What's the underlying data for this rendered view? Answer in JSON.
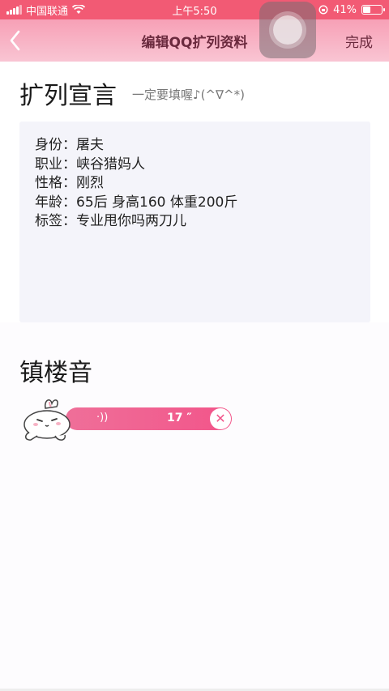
{
  "status_bar": {
    "carrier": "中国联通",
    "time": "上午5:50",
    "battery_text": "41%",
    "battery_level": 0.41,
    "background": "#f25a74"
  },
  "navbar": {
    "back_icon": "chevron-left-icon",
    "title": "编辑QQ扩列资料",
    "done_label": "完成"
  },
  "declaration": {
    "heading": "扩列宣言",
    "hint": "一定要填喔♪(^∇^*)",
    "lines": [
      "身份：屠夫",
      "职业：峡谷猎妈人",
      "性格：刚烈",
      "年龄：65后 身高160 体重200斤",
      "标签：专业甩你吗两刀儿"
    ]
  },
  "voice_section": {
    "heading": "镇楼音",
    "wave_icon": "sound-wave-icon",
    "duration": "17 ″",
    "delete_icon": "close-icon",
    "accent": "#f2558a"
  }
}
